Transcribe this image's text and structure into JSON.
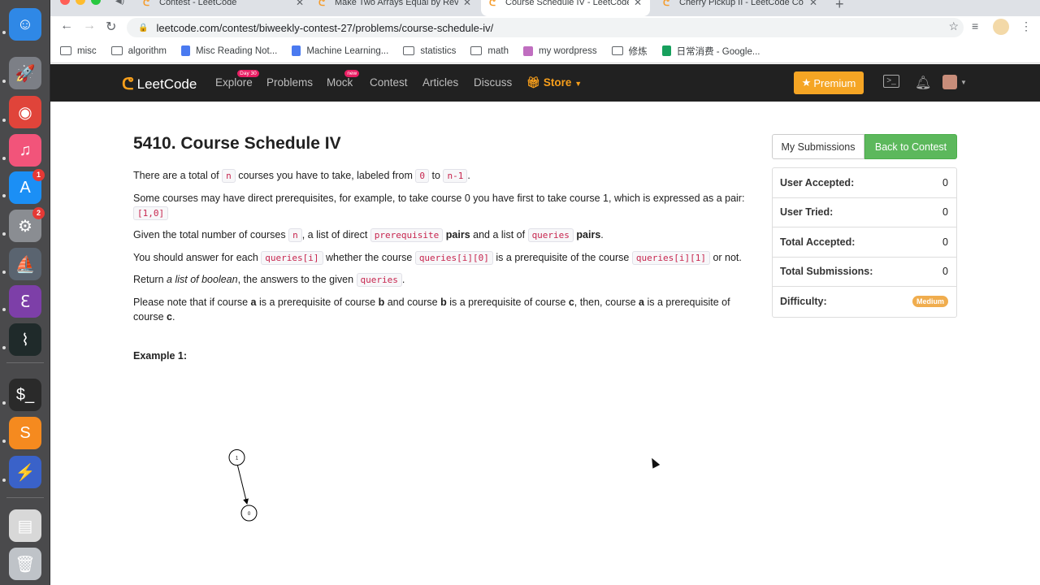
{
  "dock": {
    "items": [
      {
        "name": "finder-icon",
        "glyph": "☺",
        "color": "#2f88e6"
      },
      {
        "name": "launchpad-icon",
        "glyph": "🚀",
        "color": "#7c7f86"
      },
      {
        "name": "chrome-icon",
        "glyph": "◉",
        "color": "#e0443a"
      },
      {
        "name": "music-icon",
        "glyph": "♫",
        "color": "#f2547a"
      },
      {
        "name": "appstore-icon",
        "glyph": "A",
        "color": "#1b8ff5",
        "badge": "1"
      },
      {
        "name": "settings-icon",
        "glyph": "⚙",
        "color": "#8a8d92",
        "badge": "2"
      },
      {
        "name": "cleaner-icon",
        "glyph": "⛵",
        "color": "#5a6470"
      },
      {
        "name": "emacs-icon",
        "glyph": "ℇ",
        "color": "#7d3fa8"
      },
      {
        "name": "activity-monitor-icon",
        "glyph": "⌇",
        "color": "#1f2a2a"
      },
      {
        "name": "terminal-icon",
        "glyph": "$_",
        "color": "#2a2a2a"
      },
      {
        "name": "sublime-icon",
        "glyph": "S",
        "color": "#f58a1f"
      },
      {
        "name": "lightning-icon",
        "glyph": "⚡",
        "color": "#3a62c9"
      },
      {
        "name": "preview-icon",
        "glyph": "▤",
        "color": "#d8d8d8"
      },
      {
        "name": "trash-icon",
        "glyph": "🗑",
        "color": "#bfc3c8"
      }
    ]
  },
  "browser": {
    "tabs": [
      {
        "title": "Contest - LeetCode",
        "active": false
      },
      {
        "title": "Make Two Arrays Equal by Reve",
        "active": false
      },
      {
        "title": "Course Schedule IV - LeetCode",
        "active": true
      },
      {
        "title": "Cherry Pickup II - LeetCode Co",
        "active": false
      }
    ],
    "url": "leetcode.com/contest/biweekly-contest-27/problems/course-schedule-iv/",
    "bookmarks": [
      {
        "label": "misc",
        "icon": "folder"
      },
      {
        "label": "algorithm",
        "icon": "folder"
      },
      {
        "label": "Misc Reading Not...",
        "icon": "doc"
      },
      {
        "label": "Machine Learning...",
        "icon": "doc"
      },
      {
        "label": "statistics",
        "icon": "folder"
      },
      {
        "label": "math",
        "icon": "folder"
      },
      {
        "label": "my wordpress",
        "icon": "img"
      },
      {
        "label": "修炼",
        "icon": "folder"
      },
      {
        "label": "日常消费 - Google...",
        "icon": "sheet"
      }
    ]
  },
  "navbar": {
    "logo": "LeetCode",
    "explore": "Explore",
    "explore_badge": "Day 30",
    "problems": "Problems",
    "mock": "Mock",
    "mock_badge": "new",
    "contest": "Contest",
    "articles": "Articles",
    "discuss": "Discuss",
    "store": "Store",
    "premium": "Premium"
  },
  "problem": {
    "title": "5410. Course Schedule IV",
    "p1_a": "There are a total of",
    "p1_n": "n",
    "p1_b": "courses you have to take, labeled from",
    "p1_0": "0",
    "p1_c": "to",
    "p1_n1": "n-1",
    "p1_d": ".",
    "p2_a": "Some courses may have direct prerequisites, for example, to take course 0 you have first to take course 1, which is expressed as a pair:",
    "p2_pair": "[1,0]",
    "p3_a": "Given the total number of courses",
    "p3_n": "n",
    "p3_b": ", a list of direct",
    "p3_prereq": "prerequisite",
    "p3_pairs1": "pairs",
    "p3_c": "and a list of",
    "p3_queries": "queries",
    "p3_pairs2": "pairs",
    "p3_d": ".",
    "p4_a": "You should answer for each",
    "p4_qi": "queries[i]",
    "p4_b": "whether the course",
    "p4_qi0": "queries[i][0]",
    "p4_c": "is a prerequisite of the course",
    "p4_qi1": "queries[i][1]",
    "p4_d": "or not.",
    "p5_a": "Return",
    "p5_em": "a list of boolean",
    "p5_b": ", the answers to the given",
    "p5_queries": "queries",
    "p5_c": ".",
    "p6_a": "Please note that if course",
    "p6_a1": "a",
    "p6_b": "is a prerequisite of course",
    "p6_b1": "b",
    "p6_c": "and course",
    "p6_b2": "b",
    "p6_d": "is a prerequisite of course",
    "p6_c1": "c",
    "p6_e": ", then, course",
    "p6_a2": "a",
    "p6_f": "is a prerequisite of course",
    "p6_c2": "c",
    "p6_g": ".",
    "example_title": "Example 1:",
    "graph_nodes": [
      "1",
      "0"
    ]
  },
  "sidebar": {
    "my_submissions": "My Submissions",
    "back_to_contest": "Back to Contest",
    "stats": [
      {
        "label": "User Accepted:",
        "value": "0"
      },
      {
        "label": "User Tried:",
        "value": "0"
      },
      {
        "label": "Total Accepted:",
        "value": "0"
      },
      {
        "label": "Total Submissions:",
        "value": "0"
      }
    ],
    "difficulty_label": "Difficulty:",
    "difficulty": "Medium"
  }
}
